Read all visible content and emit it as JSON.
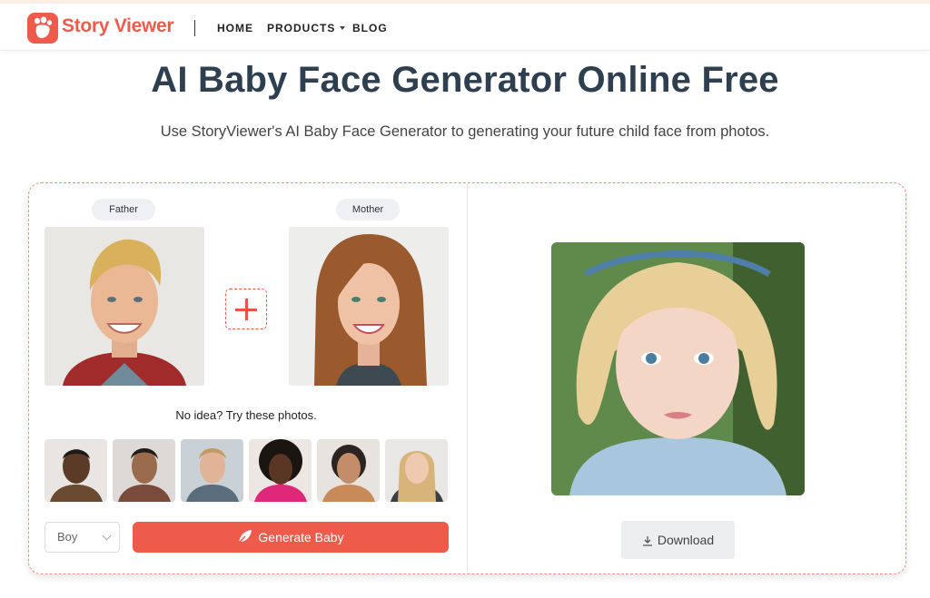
{
  "header": {
    "brand": "Story Viewer",
    "nav": [
      {
        "label": "HOME"
      },
      {
        "label": "PRODUCTS",
        "has_dropdown": true
      },
      {
        "label": "BLOG"
      }
    ]
  },
  "hero": {
    "title": "AI Baby Face Generator Online Free",
    "subtitle": "Use StoryViewer's AI Baby Face Generator to generating your future child face from photos."
  },
  "inputs": {
    "father_label": "Father",
    "mother_label": "Mother",
    "hint": "No idea? Try these photos.",
    "sample_photos": [
      "sample-photo-1",
      "sample-photo-2",
      "sample-photo-3",
      "sample-photo-4",
      "sample-photo-5",
      "sample-photo-6"
    ]
  },
  "controls": {
    "gender_value": "Boy",
    "generate_label": "Generate Baby",
    "generate_icon": "leaf-icon"
  },
  "output": {
    "download_label": "Download",
    "download_icon": "download-icon"
  },
  "colors": {
    "accent": "#ef5b4b",
    "title": "#2e3f4f"
  }
}
